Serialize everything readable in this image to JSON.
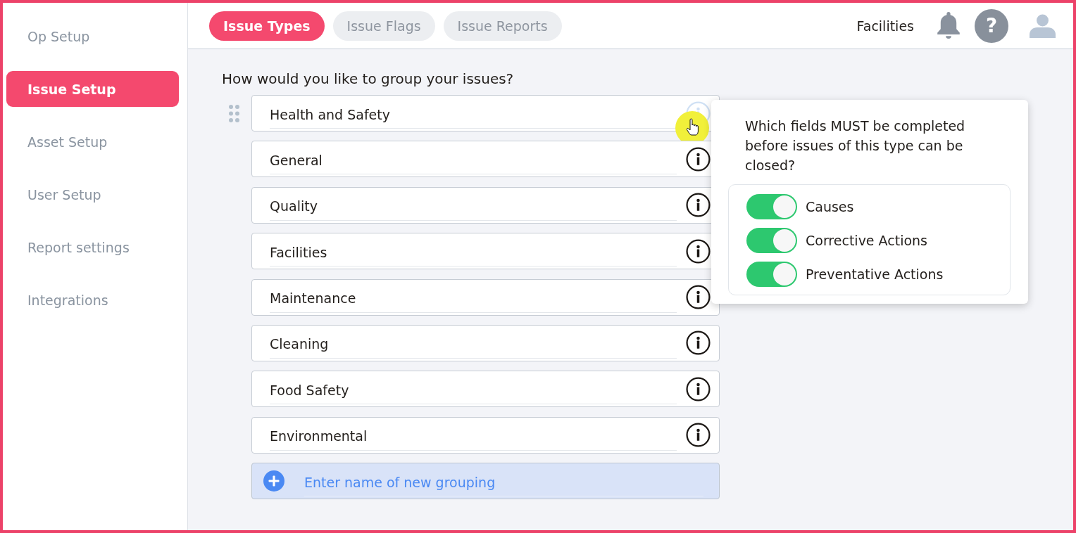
{
  "sidebar": {
    "items": [
      {
        "label": "Op Setup",
        "selected": false
      },
      {
        "label": "Issue Setup",
        "selected": true
      },
      {
        "label": "Asset Setup",
        "selected": false
      },
      {
        "label": "User Setup",
        "selected": false
      },
      {
        "label": "Report settings",
        "selected": false
      },
      {
        "label": "Integrations",
        "selected": false
      }
    ]
  },
  "tabs": [
    {
      "label": "Issue Types",
      "selected": true
    },
    {
      "label": "Issue Flags",
      "selected": false
    },
    {
      "label": "Issue Reports",
      "selected": false
    }
  ],
  "header": {
    "site": "Facilities",
    "help_label": "?"
  },
  "prompt": "How would you like to group your issues?",
  "groups": [
    {
      "name": "Health and Safety",
      "hovered": true
    },
    {
      "name": "General",
      "hovered": false
    },
    {
      "name": "Quality",
      "hovered": false
    },
    {
      "name": "Facilities",
      "hovered": false
    },
    {
      "name": "Maintenance",
      "hovered": false
    },
    {
      "name": "Cleaning",
      "hovered": false
    },
    {
      "name": "Food Safety",
      "hovered": false
    },
    {
      "name": "Environmental",
      "hovered": false
    }
  ],
  "new_group": {
    "placeholder": "Enter name of new grouping"
  },
  "popover": {
    "question": "Which fields MUST be completed before issues of this type can be closed?",
    "toggles": [
      {
        "label": "Causes",
        "on": true
      },
      {
        "label": "Corrective Actions",
        "on": true
      },
      {
        "label": "Preventative Actions",
        "on": true
      }
    ]
  }
}
